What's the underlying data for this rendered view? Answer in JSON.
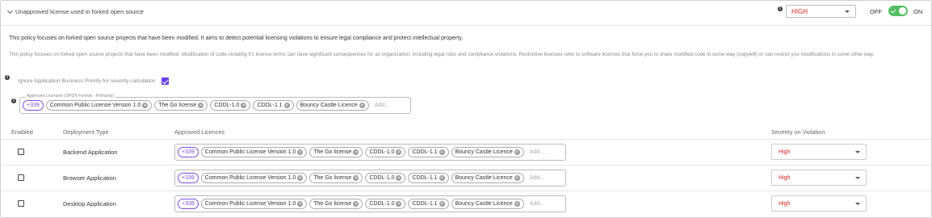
{
  "header": {
    "title": "Unapproved license used in forked open source",
    "severity": "HIGH",
    "off_label": "OFF",
    "on_label": "ON",
    "toggle_on": true,
    "accent": "#53c062",
    "severity_color": "#d32020"
  },
  "description": {
    "short": "This policy focuses on forked open source projects that have been modified. It aims to detect potential licensing violations to ensure legal compliance and protect intellectual property.",
    "long": "This policy focuses on forked open source projects that have been modified. Modification of code violating it's license terms can have significant consequences for an organization, including legal risks and compliance violations. Restrictive licenses refer to software licenses that force you to share modified code in some way (copyleft) or can restrict you modifications in some other way."
  },
  "ignore_priority": {
    "label": "Ignore Application Business Priority for severity calculation",
    "checked": true
  },
  "approved_licenses": {
    "legend": "Approved Licenses (SPDX Format - Primarily)",
    "count": "+339",
    "chips": [
      "Common Public License Version 1.0",
      "The Go license",
      "CDDL-1.0",
      "CDDL-1.1",
      "Bouncy Castle Licence"
    ],
    "placeholder": "Add..."
  },
  "table": {
    "headers": {
      "enabled": "Enabled",
      "deployment_type": "Deployment Type",
      "approved_licences": "Approved Licences",
      "severity": "Severity on Violation"
    },
    "rows": [
      {
        "name": "Backend Application",
        "enabled": false,
        "count": "+339",
        "chips": [
          "Common Public License Version 1.0",
          "The Go license",
          "CDDL-1.0",
          "CDDL-1.1",
          "Bouncy Castle Licence"
        ],
        "placeholder": "Add...",
        "severity": "High"
      },
      {
        "name": "Browser Application",
        "enabled": false,
        "count": "+339",
        "chips": [
          "Common Public License Version 1.0",
          "The Go license",
          "CDDL-1.0",
          "CDDL-1.1",
          "Bouncy Castle Licence"
        ],
        "placeholder": "Add...",
        "severity": "High"
      },
      {
        "name": "Desktop Application",
        "enabled": false,
        "count": "+339",
        "chips": [
          "Common Public License Version 1.0",
          "The Go license",
          "CDDL-1.0",
          "CDDL-1.1",
          "Bouncy Castle Licence"
        ],
        "placeholder": "Add...",
        "severity": "High"
      }
    ]
  }
}
